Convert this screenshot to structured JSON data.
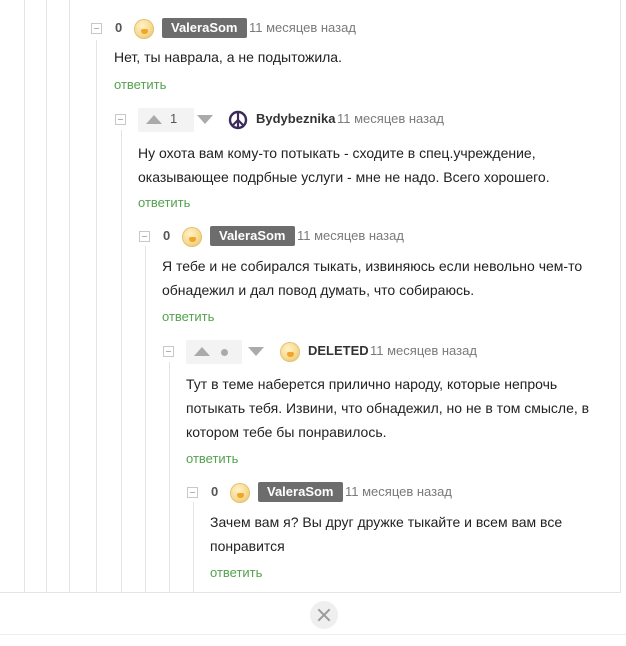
{
  "comments": [
    {
      "rating": "0",
      "username": "ValeraSom",
      "time": "11 месяцев назад",
      "lines": [
        "Нет, ты наврала, а не подытожила."
      ],
      "reply": "ответить"
    },
    {
      "rating": "1",
      "username": "Bydybeznika",
      "time": "11 месяцев назад",
      "lines": [
        "Ну охота вам кому-то потыкать - сходите в спец.учреждение,",
        "оказывающее подрбные услуги - мне не надо. Всего хорошего."
      ],
      "reply": "ответить"
    },
    {
      "rating": "0",
      "username": "ValeraSom",
      "time": "11 месяцев назад",
      "lines": [
        "Я тебе и не собирался тыкать, извиняюсь если невольно чем-то",
        "обнадежил и дал повод думать, что собираюсь."
      ],
      "reply": "ответить"
    },
    {
      "username": "DELETED",
      "time": "11 месяцев назад",
      "lines": [
        "Тут в теме наберется прилично народу, которые непрочь",
        "потыкать тебя. Извини, что обнадежил, но не в том смысле, в",
        "котором тебе бы понравилось."
      ],
      "reply": "ответить"
    },
    {
      "rating": "0",
      "username": "ValeraSom",
      "time": "11 месяцев назад",
      "lines": [
        "Зачем вам я? Вы друг дружке тыкайте и всем вам все",
        "понравится"
      ],
      "reply": "ответить"
    }
  ],
  "colors": {
    "reply_link": "#54a14f",
    "badge_bg": "#6d6d6d"
  },
  "icons": {
    "collapse": "minus-square-icon",
    "upvote": "arrow-up-icon",
    "downvote": "arrow-down-icon",
    "close": "close-icon",
    "user2": "peace-sign-icon"
  }
}
